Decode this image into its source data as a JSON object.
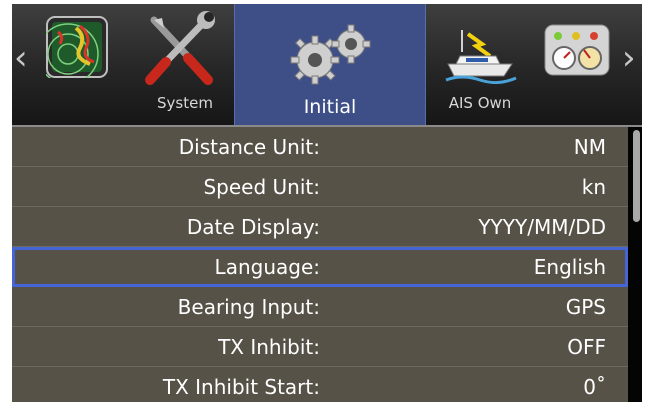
{
  "nav": {
    "prev_arrow": "‹",
    "next_arrow": "›"
  },
  "tabs": [
    {
      "icon": "radar-icon",
      "label": ""
    },
    {
      "icon": "tools-icon",
      "label": "System"
    },
    {
      "icon": "gears-icon",
      "label": "Initial",
      "active": true
    },
    {
      "icon": "ship-icon",
      "label": "AIS Own"
    },
    {
      "icon": "gauges-icon",
      "label": ""
    }
  ],
  "settings": [
    {
      "label": "Distance Unit:",
      "value": "NM"
    },
    {
      "label": "Speed Unit:",
      "value": "kn"
    },
    {
      "label": "Date Display:",
      "value": "YYYY/MM/DD"
    },
    {
      "label": "Language:",
      "value": "English",
      "selected": true
    },
    {
      "label": "Bearing Input:",
      "value": "GPS"
    },
    {
      "label": "TX Inhibit:",
      "value": "OFF"
    },
    {
      "label": "TX Inhibit Start:",
      "value": "0˚"
    }
  ],
  "colors": {
    "active_tab": "#3e4f87",
    "selection_outline": "#4565d6",
    "menu_bg": "#575248"
  }
}
